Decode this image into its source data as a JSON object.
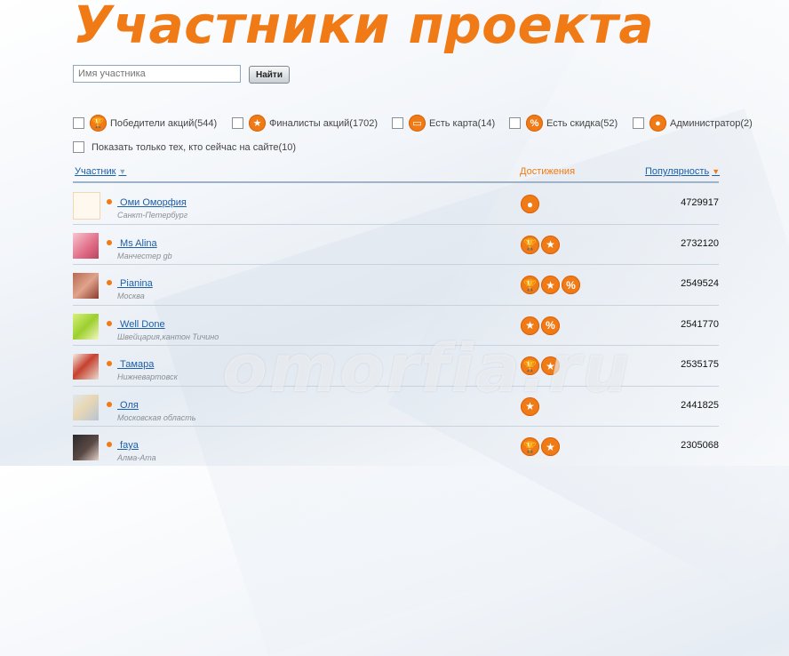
{
  "title": "Участники проекта",
  "search": {
    "placeholder": "Имя участника",
    "button_label": "Найти"
  },
  "filters": [
    {
      "icon": "trophy-icon",
      "glyph": "🏆",
      "label": "Победители акций(544)"
    },
    {
      "icon": "star-icon",
      "glyph": "★",
      "label": "Финалисты акций(1702)"
    },
    {
      "icon": "card-icon",
      "glyph": "▭",
      "label": "Есть карта(14)"
    },
    {
      "icon": "percent-icon",
      "glyph": "%",
      "label": "Есть скидка(52)"
    },
    {
      "icon": "admin-icon",
      "glyph": "●",
      "label": "Администратор(2)"
    }
  ],
  "online_filter": {
    "label": "Показать только тех, кто сейчас на сайте(10)"
  },
  "table": {
    "col_user": "Участник",
    "col_achievements": "Достижения",
    "col_popularity": "Популярность",
    "sort_user_arrow": "▼",
    "sort_pop_arrow": "▼"
  },
  "watermark": "omorfia.ru",
  "colors": {
    "accent": "#f07a15",
    "link": "#1b5fa8",
    "muted": "#8a8f96"
  },
  "members": [
    {
      "name": " Оми Оморфия",
      "city": "Санкт-Петербург",
      "badges": [
        "admin"
      ],
      "popularity": "4729917",
      "avatar": "logo"
    },
    {
      "name": " Ms Alina",
      "city": "Манчестер gb",
      "badges": [
        "trophy",
        "star"
      ],
      "popularity": "2732120",
      "avatar": "pink"
    },
    {
      "name": " Pianina",
      "city": "Москва",
      "badges": [
        "trophy",
        "star",
        "percent"
      ],
      "popularity": "2549524",
      "avatar": "red"
    },
    {
      "name": " Well Done",
      "city": "Швейцария,кантон Тичино",
      "badges": [
        "star",
        "percent"
      ],
      "popularity": "2541770",
      "avatar": "green"
    },
    {
      "name": " Тамара",
      "city": "Нижневартовск",
      "badges": [
        "trophy",
        "star"
      ],
      "popularity": "2535175",
      "avatar": "flowers"
    },
    {
      "name": " Оля",
      "city": "Московская область",
      "badges": [
        "star"
      ],
      "popularity": "2441825",
      "avatar": "blonde"
    },
    {
      "name": " faya",
      "city": "Алма-Ата",
      "badges": [
        "trophy",
        "star"
      ],
      "popularity": "2305068",
      "avatar": "dark"
    }
  ]
}
